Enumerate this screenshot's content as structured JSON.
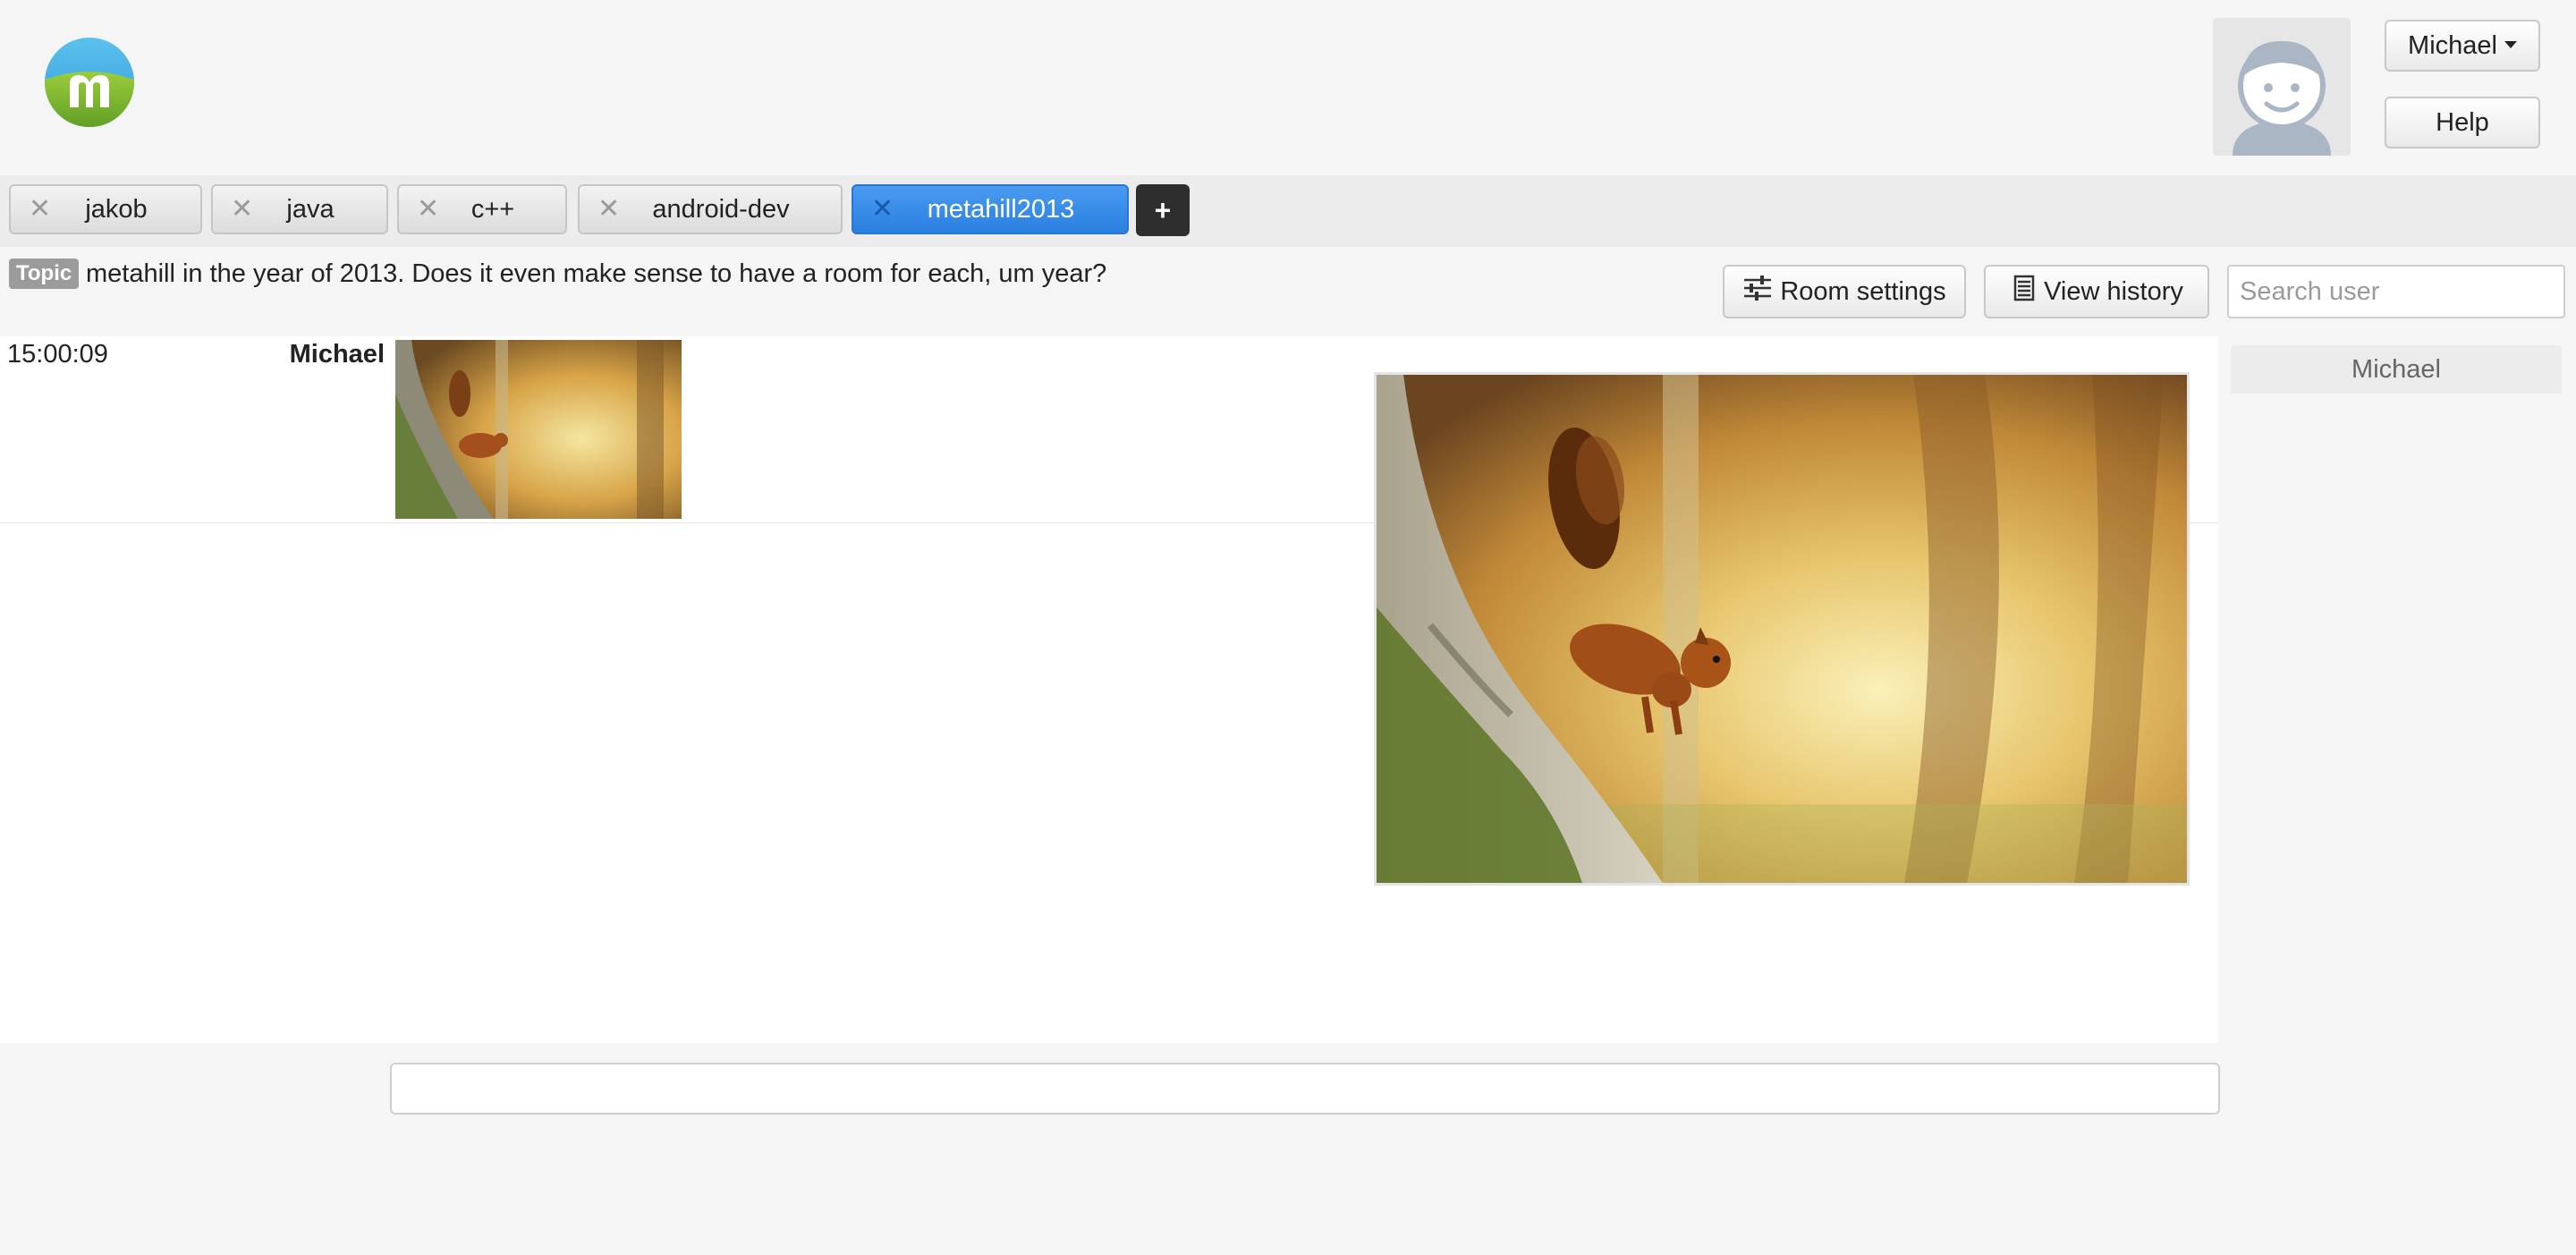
{
  "header": {
    "user_menu_label": "Michael",
    "help_label": "Help"
  },
  "tabs": [
    {
      "label": "jakob",
      "active": false
    },
    {
      "label": "java",
      "active": false
    },
    {
      "label": "c++",
      "active": false
    },
    {
      "label": "android-dev",
      "active": false
    },
    {
      "label": "metahill2013",
      "active": true
    }
  ],
  "tab_close_glyph": "✕",
  "tab_add_label": "+",
  "topic": {
    "badge": "Topic",
    "text": "metahill in the year of 2013. Does it even make sense to have a room for each, um year?"
  },
  "toolbar": {
    "room_settings_label": "Room settings",
    "view_history_label": "View history",
    "search_placeholder": "Search user"
  },
  "messages": [
    {
      "time": "15:00:09",
      "user": "Michael",
      "attachment": "squirrel-image"
    }
  ],
  "userlist": [
    "Michael"
  ],
  "message_input": {
    "value": "",
    "placeholder": ""
  },
  "colors": {
    "active_tab": "#2f86e6",
    "add_tab_bg": "#2e2e2e",
    "topic_badge": "#9b9b9b",
    "logo_sky": "#39a9e0",
    "logo_hill": "#7ab935"
  },
  "icons": {
    "room_settings": "sliders-icon",
    "view_history": "list-icon",
    "tab_close": "close-icon",
    "logo": "metahill-logo",
    "avatar": "default-avatar-icon"
  }
}
